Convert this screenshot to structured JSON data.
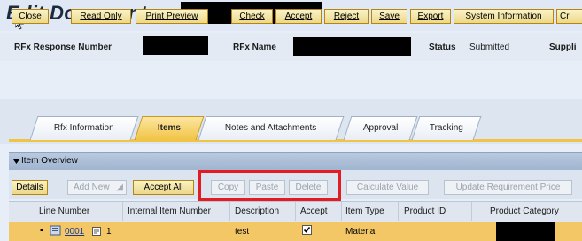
{
  "title": {
    "text": "Edit Document:"
  },
  "header": {
    "rfx_response_number_label": "RFx Response Number",
    "rfx_name_label": "RFx Name",
    "status_label": "Status",
    "status_value": "Submitted",
    "supplier_label": "Suppli"
  },
  "toolbar": {
    "buttons": [
      "Close",
      "Read Only",
      "Print Preview",
      "Check",
      "Accept",
      "Reject",
      "Save",
      "Export",
      "System Information",
      "Cr"
    ]
  },
  "tabs": [
    "Rfx Information",
    "Items",
    "Notes and Attachments",
    "Approval",
    "Tracking"
  ],
  "active_tab": "Items",
  "item_overview": {
    "title": "Item Overview",
    "buttons": {
      "details": "Details",
      "add_new": "Add New",
      "accept_all": "Accept All",
      "copy": "Copy",
      "paste": "Paste",
      "delete": "Delete",
      "calculate_value": "Calculate Value",
      "update_requirement_price": "Update Requirement Price"
    },
    "columns": [
      "Line Number",
      "Internal Item Number",
      "Description",
      "Accept",
      "Item Type",
      "Product ID",
      "Product Category"
    ],
    "rows": [
      {
        "line_number": "0001",
        "internal_item_number": "1",
        "description": "test",
        "accept": true,
        "item_type": "Material",
        "product_id": ""
      }
    ]
  },
  "colors": {
    "highlight": "#e31b23",
    "selected_row": "#f4c766",
    "button_gold": "#ecd889"
  }
}
